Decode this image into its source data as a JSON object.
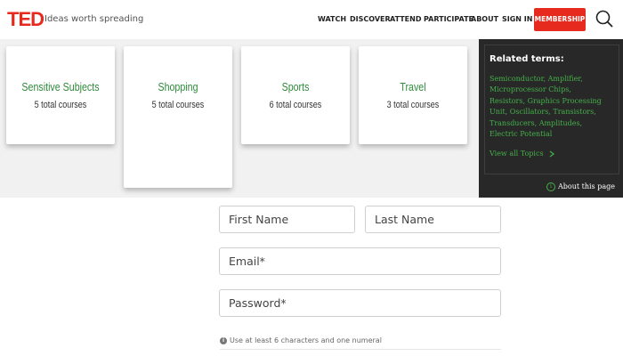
{
  "header": {
    "logo": "TED",
    "tagline": "Ideas worth spreading",
    "nav": [
      "WATCH",
      "DISCOVER",
      "ATTEND",
      "PARTICIPATE",
      "ABOUT",
      "SIGN IN"
    ],
    "membership": "MEMBERSHIP",
    "search_icon": "search-icon"
  },
  "topics": [
    {
      "title": "Sensitive Subjects",
      "count": "5 total courses"
    },
    {
      "title": "Shopping",
      "count": "5 total courses"
    },
    {
      "title": "Sports",
      "count": "6 total courses"
    },
    {
      "title": "Travel",
      "count": "3 total courses"
    }
  ],
  "sidebar": {
    "heading": "Related terms:",
    "terms": "Semiconductor, Amplifier, Microprocessor Chips, Resistors, Graphics Processing Unit, Oscillators, Transistors, Transducers, Amplitudes, Electric Potential",
    "view_all": "View all Topics",
    "about": "About this page"
  },
  "form": {
    "first_name_placeholder": "First Name",
    "last_name_placeholder": "Last Name",
    "email_placeholder": "Email*",
    "password_placeholder": "Password*",
    "hint": "Use at least 6 characters and one numeral"
  },
  "colors": {
    "brand_red": "#e62b1e",
    "link_green": "#44b049",
    "sidebar_bg": "#282828"
  }
}
